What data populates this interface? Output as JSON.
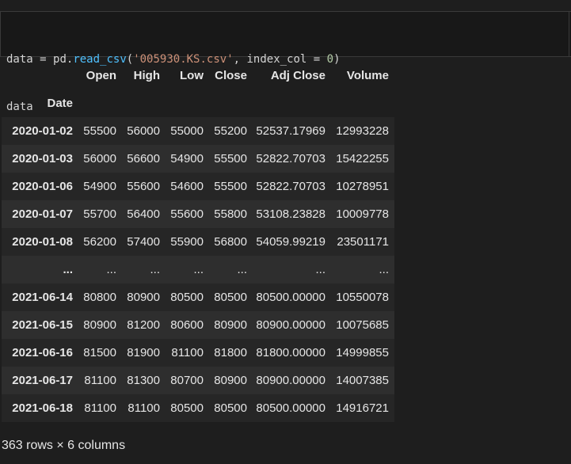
{
  "code_cell": {
    "line1": {
      "var": "data",
      "eq": " = ",
      "mod": "pd.",
      "fn": "read_csv",
      "open": "(",
      "str": "'005930.KS.csv'",
      "mid": ", index_col ",
      "eq2": "=",
      "sp": " ",
      "num": "0",
      "close": ")"
    },
    "line2": "data"
  },
  "dataframe": {
    "columns": [
      "Open",
      "High",
      "Low",
      "Close",
      "Adj Close",
      "Volume"
    ],
    "index_name": "Date",
    "rows": [
      {
        "index": "2020-01-02",
        "values": [
          "55500",
          "56000",
          "55000",
          "55200",
          "52537.17969",
          "12993228"
        ]
      },
      {
        "index": "2020-01-03",
        "values": [
          "56000",
          "56600",
          "54900",
          "55500",
          "52822.70703",
          "15422255"
        ]
      },
      {
        "index": "2020-01-06",
        "values": [
          "54900",
          "55600",
          "54600",
          "55500",
          "52822.70703",
          "10278951"
        ]
      },
      {
        "index": "2020-01-07",
        "values": [
          "55700",
          "56400",
          "55600",
          "55800",
          "53108.23828",
          "10009778"
        ]
      },
      {
        "index": "2020-01-08",
        "values": [
          "56200",
          "57400",
          "55900",
          "56800",
          "54059.99219",
          "23501171"
        ]
      },
      {
        "index": "...",
        "values": [
          "...",
          "...",
          "...",
          "...",
          "...",
          "..."
        ]
      },
      {
        "index": "2021-06-14",
        "values": [
          "80800",
          "80900",
          "80500",
          "80500",
          "80500.00000",
          "10550078"
        ]
      },
      {
        "index": "2021-06-15",
        "values": [
          "80900",
          "81200",
          "80600",
          "80900",
          "80900.00000",
          "10075685"
        ]
      },
      {
        "index": "2021-06-16",
        "values": [
          "81500",
          "81900",
          "81100",
          "81800",
          "81800.00000",
          "14999855"
        ]
      },
      {
        "index": "2021-06-17",
        "values": [
          "81100",
          "81300",
          "80700",
          "80900",
          "80900.00000",
          "14007385"
        ]
      },
      {
        "index": "2021-06-18",
        "values": [
          "81100",
          "81100",
          "80500",
          "80500",
          "80500.00000",
          "14916721"
        ]
      }
    ],
    "shape_text": "363 rows × 6 columns"
  }
}
